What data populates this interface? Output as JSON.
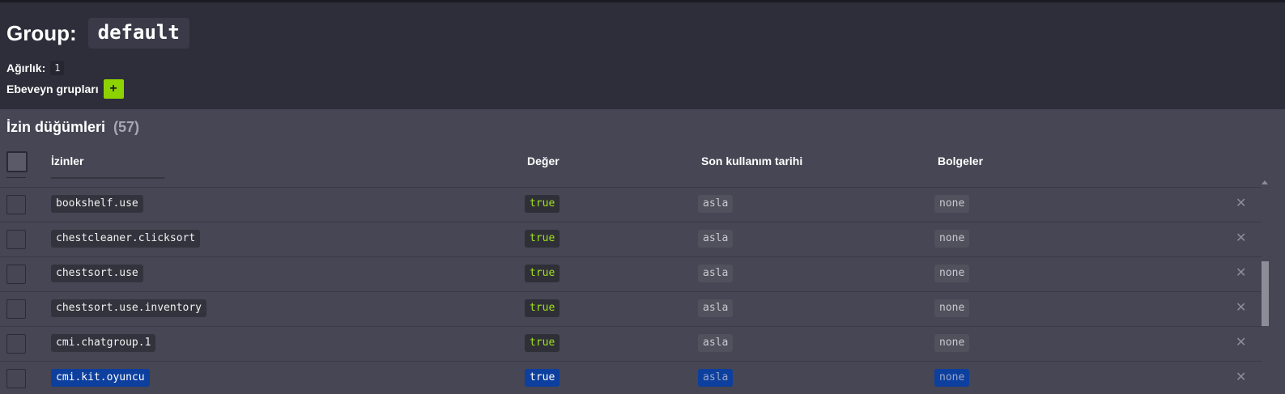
{
  "header": {
    "group_label": "Group:",
    "group_name": "default",
    "weight_label": "Ağırlık:",
    "weight_value": "1",
    "parents_label": "Ebeveyn grupları",
    "add_parent_label": "+"
  },
  "permissions": {
    "title": "İzin düğümleri",
    "count": "(57)",
    "columns": {
      "permission": "İzinler",
      "value": "Değer",
      "last_used": "Son kullanım tarihi",
      "contexts": "Bolgeler"
    },
    "rows": [
      {
        "node": "bookshelf.use",
        "value": "true",
        "last_used": "asla",
        "contexts": "none",
        "selected": false
      },
      {
        "node": "chestcleaner.clicksort",
        "value": "true",
        "last_used": "asla",
        "contexts": "none",
        "selected": false
      },
      {
        "node": "chestsort.use",
        "value": "true",
        "last_used": "asla",
        "contexts": "none",
        "selected": false
      },
      {
        "node": "chestsort.use.inventory",
        "value": "true",
        "last_used": "asla",
        "contexts": "none",
        "selected": false
      },
      {
        "node": "cmi.chatgroup.1",
        "value": "true",
        "last_used": "asla",
        "contexts": "none",
        "selected": false
      },
      {
        "node": "cmi.kit.oyuncu",
        "value": "true",
        "last_used": "asla",
        "contexts": "none",
        "selected": true
      }
    ],
    "delete_icon": "close-icon",
    "delete_glyph": "✕"
  },
  "colors": {
    "header_bg": "#2e2e3a",
    "section_bg": "#464654",
    "true_value": "#9fe21b",
    "add_button": "#8dd300",
    "selection": "#0d3f9e"
  }
}
